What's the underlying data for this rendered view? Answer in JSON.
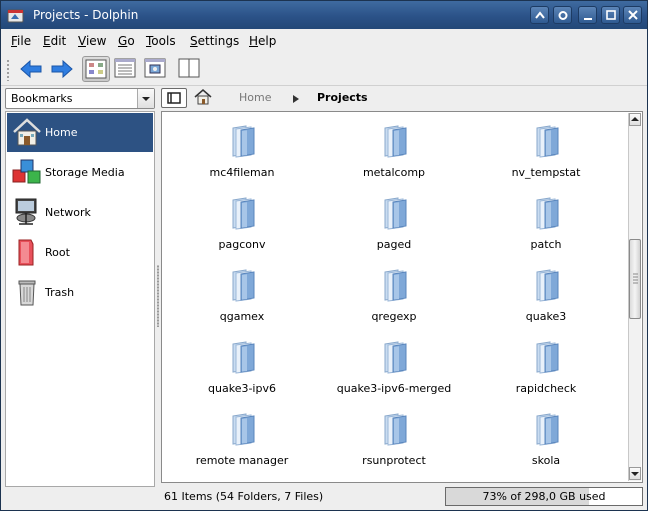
{
  "window": {
    "title": "Projects - Dolphin"
  },
  "menubar": [
    {
      "label": "File",
      "accel": "F",
      "rest": "ile"
    },
    {
      "label": "Edit",
      "accel": "E",
      "rest": "dit"
    },
    {
      "label": "View",
      "accel": "V",
      "rest": "iew"
    },
    {
      "label": "Go",
      "accel": "G",
      "rest": "o"
    },
    {
      "label": "Tools",
      "accel": "T",
      "rest": "ools"
    },
    {
      "label": "Settings",
      "accel": "S",
      "rest": "ettings"
    },
    {
      "label": "Help",
      "accel": "H",
      "rest": "elp"
    }
  ],
  "toolbar": {
    "icons": [
      "back-arrow-icon",
      "forward-arrow-icon",
      "icons-view-icon",
      "details-view-icon",
      "preview-view-icon",
      "split-view-icon"
    ],
    "active_view": "icons"
  },
  "sidebar": {
    "selector_value": "Bookmarks",
    "items": [
      {
        "label": "Home",
        "icon": "home-icon",
        "selected": true
      },
      {
        "label": "Storage Media",
        "icon": "storage-media-icon",
        "selected": false
      },
      {
        "label": "Network",
        "icon": "network-icon",
        "selected": false
      },
      {
        "label": "Root",
        "icon": "root-folder-icon",
        "selected": false
      },
      {
        "label": "Trash",
        "icon": "trash-icon",
        "selected": false
      }
    ]
  },
  "breadcrumb": {
    "parent": "Home",
    "current": "Projects"
  },
  "files": [
    "mc4fileman",
    "metalcomp",
    "nv_tempstat",
    "pagconv",
    "paged",
    "patch",
    "qgamex",
    "qregexp",
    "quake3",
    "quake3-ipv6",
    "quake3-ipv6-merged",
    "rapidcheck",
    "remote manager",
    "rsunprotect",
    "skola"
  ],
  "status": {
    "summary": "61 Items (54 Folders, 7 Files)",
    "disk_text": "73% of 298,0 GB used",
    "disk_used_fraction": 0.73
  },
  "colors": {
    "titlebar": "#2b5288",
    "selection": "#2d5283",
    "folder": "#7fa8d8"
  }
}
